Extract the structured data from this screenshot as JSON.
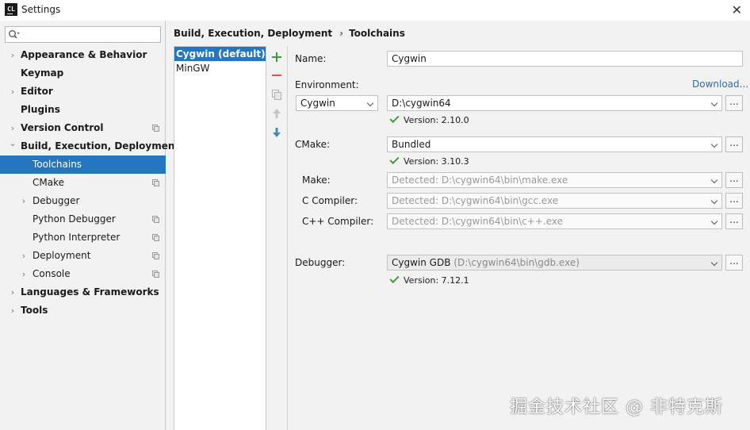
{
  "window": {
    "title": "Settings",
    "app_icon_text": "CL"
  },
  "search": {
    "placeholder": "",
    "value": ""
  },
  "sidebar": {
    "items": [
      {
        "label": "Appearance & Behavior",
        "expandable": true,
        "level": 0,
        "bold": true,
        "selected": false,
        "copy_icon": false
      },
      {
        "label": "Keymap",
        "expandable": false,
        "level": 0,
        "bold": true,
        "selected": false,
        "copy_icon": false
      },
      {
        "label": "Editor",
        "expandable": true,
        "level": 0,
        "bold": true,
        "selected": false,
        "copy_icon": false
      },
      {
        "label": "Plugins",
        "expandable": false,
        "level": 0,
        "bold": true,
        "selected": false,
        "copy_icon": false
      },
      {
        "label": "Version Control",
        "expandable": true,
        "level": 0,
        "bold": true,
        "selected": false,
        "copy_icon": true
      },
      {
        "label": "Build, Execution, Deployment",
        "expandable": true,
        "expanded": true,
        "level": 0,
        "bold": true,
        "selected": false,
        "copy_icon": false
      },
      {
        "label": "Toolchains",
        "expandable": false,
        "level": 1,
        "bold": false,
        "selected": true,
        "copy_icon": false
      },
      {
        "label": "CMake",
        "expandable": false,
        "level": 1,
        "bold": false,
        "selected": false,
        "copy_icon": true
      },
      {
        "label": "Debugger",
        "expandable": true,
        "level": 1,
        "bold": false,
        "selected": false,
        "copy_icon": false
      },
      {
        "label": "Python Debugger",
        "expandable": false,
        "level": 1,
        "bold": false,
        "selected": false,
        "copy_icon": true
      },
      {
        "label": "Python Interpreter",
        "expandable": false,
        "level": 1,
        "bold": false,
        "selected": false,
        "copy_icon": true
      },
      {
        "label": "Deployment",
        "expandable": true,
        "level": 1,
        "bold": false,
        "selected": false,
        "copy_icon": true
      },
      {
        "label": "Console",
        "expandable": true,
        "level": 1,
        "bold": false,
        "selected": false,
        "copy_icon": true
      },
      {
        "label": "Languages & Frameworks",
        "expandable": true,
        "level": 0,
        "bold": true,
        "selected": false,
        "copy_icon": false
      },
      {
        "label": "Tools",
        "expandable": true,
        "level": 0,
        "bold": true,
        "selected": false,
        "copy_icon": false
      }
    ]
  },
  "breadcrumb": {
    "parent": "Build, Execution, Deployment",
    "separator": "›",
    "current": "Toolchains"
  },
  "toolchains": {
    "items": [
      {
        "label": "Cygwin (default)",
        "selected": true
      },
      {
        "label": "MinGW",
        "selected": false
      }
    ],
    "toolbar": [
      "add-icon",
      "remove-icon",
      "copy-icon",
      "move-up-icon",
      "move-down-icon"
    ]
  },
  "form": {
    "name_label": "Name:",
    "name_value": "Cygwin",
    "environment_label": "Environment:",
    "download_link": "Download...",
    "env_type": "Cygwin",
    "env_path": "D:\\cygwin64",
    "env_version": "Version: 2.10.0",
    "cmake_label": "CMake:",
    "cmake_value": "Bundled",
    "cmake_version": "Version: 3.10.3",
    "make_label": "Make:",
    "make_value": "Detected: D:\\cygwin64\\bin\\make.exe",
    "c_compiler_label": "C Compiler:",
    "c_compiler_value": "Detected: D:\\cygwin64\\bin\\gcc.exe",
    "cpp_compiler_label": "C++ Compiler:",
    "cpp_compiler_value": "Detected: D:\\cygwin64\\bin\\c++.exe",
    "debugger_label": "Debugger:",
    "debugger_name": "Cygwin GDB",
    "debugger_path": "(D:\\cygwin64\\bin\\gdb.exe)",
    "debugger_version": "Version: 7.12.1",
    "browse_label": "..."
  },
  "watermark": "掘金技术社区 @ 非特克斯",
  "colors": {
    "selection": "#2675bf",
    "link": "#2470b3",
    "check": "#3f9a3f",
    "add": "#3f9a3f",
    "remove": "#d9534f"
  }
}
